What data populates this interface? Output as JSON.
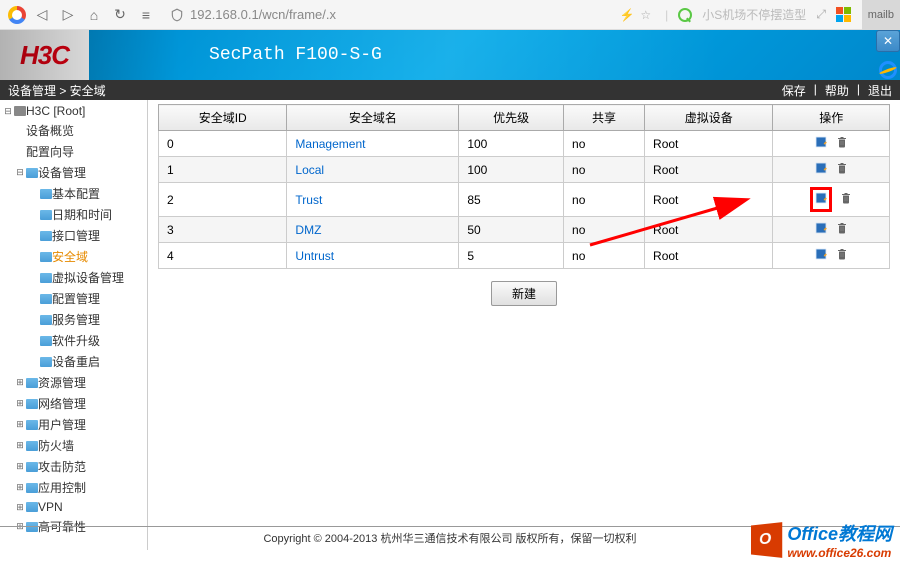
{
  "browser": {
    "url": "192.168.0.1/wcn/frame/.x",
    "search_placeholder": "小S机场不停摆造型",
    "tab_right": "mailb"
  },
  "header": {
    "logo": "H3C",
    "product": "SecPath F100-S-G"
  },
  "breadcrumb": {
    "path": "设备管理 > 安全域",
    "save": "保存",
    "help": "帮助",
    "logout": "退出"
  },
  "tree": [
    {
      "label": "H3C [Root]",
      "level": 0,
      "icon": "server",
      "toggle": "−"
    },
    {
      "label": "设备概览",
      "level": 1,
      "icon": "",
      "toggle": ""
    },
    {
      "label": "配置向导",
      "level": 1,
      "icon": "",
      "toggle": ""
    },
    {
      "label": "设备管理",
      "level": 1,
      "icon": "folder",
      "toggle": "−"
    },
    {
      "label": "基本配置",
      "level": 2,
      "icon": "folder",
      "toggle": ""
    },
    {
      "label": "日期和时间",
      "level": 2,
      "icon": "folder",
      "toggle": ""
    },
    {
      "label": "接口管理",
      "level": 2,
      "icon": "folder",
      "toggle": ""
    },
    {
      "label": "安全域",
      "level": 2,
      "icon": "folder",
      "toggle": "",
      "active": true
    },
    {
      "label": "虚拟设备管理",
      "level": 2,
      "icon": "folder",
      "toggle": ""
    },
    {
      "label": "配置管理",
      "level": 2,
      "icon": "folder",
      "toggle": ""
    },
    {
      "label": "服务管理",
      "level": 2,
      "icon": "folder",
      "toggle": ""
    },
    {
      "label": "软件升级",
      "level": 2,
      "icon": "folder",
      "toggle": ""
    },
    {
      "label": "设备重启",
      "level": 2,
      "icon": "folder",
      "toggle": ""
    },
    {
      "label": "资源管理",
      "level": 1,
      "icon": "folder",
      "toggle": "+"
    },
    {
      "label": "网络管理",
      "level": 1,
      "icon": "folder",
      "toggle": "+"
    },
    {
      "label": "用户管理",
      "level": 1,
      "icon": "folder",
      "toggle": "+"
    },
    {
      "label": "防火墙",
      "level": 1,
      "icon": "folder",
      "toggle": "+"
    },
    {
      "label": "攻击防范",
      "level": 1,
      "icon": "folder",
      "toggle": "+"
    },
    {
      "label": "应用控制",
      "level": 1,
      "icon": "folder",
      "toggle": "+"
    },
    {
      "label": "VPN",
      "level": 1,
      "icon": "folder",
      "toggle": "+"
    },
    {
      "label": "高可靠性",
      "level": 1,
      "icon": "folder",
      "toggle": "+"
    }
  ],
  "table": {
    "headers": [
      "安全域ID",
      "安全域名",
      "优先级",
      "共享",
      "虚拟设备",
      "操作"
    ],
    "rows": [
      {
        "id": "0",
        "name": "Management",
        "priority": "100",
        "share": "no",
        "device": "Root",
        "highlight": false
      },
      {
        "id": "1",
        "name": "Local",
        "priority": "100",
        "share": "no",
        "device": "Root",
        "highlight": false
      },
      {
        "id": "2",
        "name": "Trust",
        "priority": "85",
        "share": "no",
        "device": "Root",
        "highlight": true
      },
      {
        "id": "3",
        "name": "DMZ",
        "priority": "50",
        "share": "no",
        "device": "Root",
        "highlight": false
      },
      {
        "id": "4",
        "name": "Untrust",
        "priority": "5",
        "share": "no",
        "device": "Root",
        "highlight": false
      }
    ]
  },
  "buttons": {
    "new": "新建"
  },
  "footer": "Copyright © 2004-2013 杭州华三通信技术有限公司 版权所有，保留一切权利",
  "watermark": {
    "title": "Office教程网",
    "url": "www.office26.com"
  }
}
